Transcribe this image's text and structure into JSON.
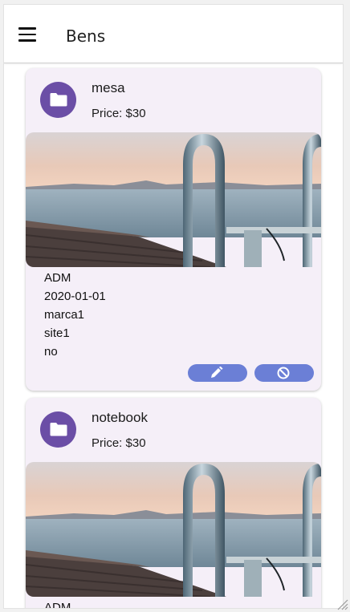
{
  "appbar": {
    "title": "Bens",
    "menu_icon": "menu-icon"
  },
  "cards": [
    {
      "name": "mesa",
      "price": "Price: $30",
      "avatar_icon": "folder-icon",
      "image": "lake-pier-ladder-photo",
      "details": [
        "ADM",
        "2020-01-01",
        "marca1",
        "site1",
        "no"
      ],
      "actions": [
        {
          "icon": "edit-icon"
        },
        {
          "icon": "block-icon"
        }
      ]
    },
    {
      "name": "notebook",
      "price": "Price: $30",
      "avatar_icon": "folder-icon",
      "image": "lake-pier-ladder-photo",
      "details": [
        "ADM"
      ]
    }
  ],
  "colors": {
    "card_bg": "#f5eff8",
    "avatar": "#6b4ea6",
    "action_button": "#6b7fd6"
  }
}
